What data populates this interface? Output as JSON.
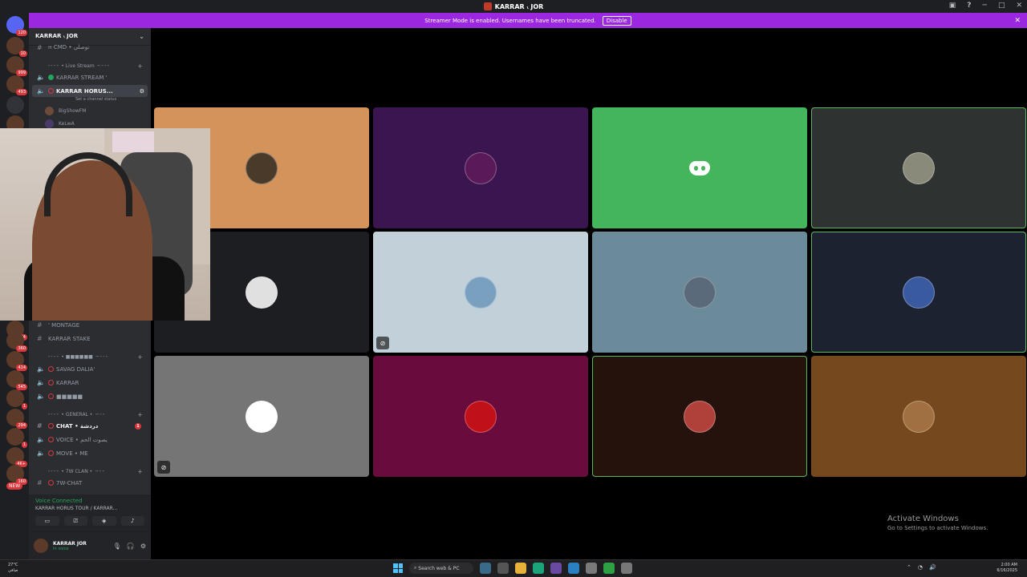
{
  "window": {
    "title": "KARRAR ៶ JOR"
  },
  "banner": {
    "text": "Streamer Mode is enabled. Usernames have been truncated.",
    "button": "Disable"
  },
  "guild_badges": [
    "120",
    "10",
    "999",
    "493",
    "34",
    "360",
    "414",
    "545",
    "1",
    "294",
    "1",
    "4K+",
    "160"
  ],
  "guild_new": "NEW",
  "server": {
    "name": "KARRAR ៶ JOR"
  },
  "sidebar": {
    "top_channel": "ʜ CMD • توصلی",
    "categories": {
      "live": "╴╴╴╴ • Live Stream ╶╴╴╴╴",
      "cat2": "╴╴╴╴ • ■■■■■■ ╶╴╴╴╴",
      "general": "╴╴╴╴ • GENERAL • ╶╴╴╴",
      "clan": "╴╴╴╴ • 7W CLAN • ╶╴╴╴"
    },
    "channels": {
      "stream": "KARRAR STREAM ' ",
      "horus": "KARRAR HORUS...",
      "montage": "' MONTAGE",
      "stake": "KARRAR STAKE",
      "savag": "SAVAG DALIA'",
      "karrar": "KARRAR",
      "blocks": "■■■■■",
      "chat": "CHAT • دردشة",
      "voice": "VOICE • يصوت الحم",
      "move": "MOVE • ME",
      "clanchat": "7W-CHAT"
    },
    "channel_status": "Set a channel status",
    "voice_users": [
      "BigShowFM",
      "KeLwA"
    ],
    "chat_unread": "1"
  },
  "voice_panel": {
    "title": "Voice Connected",
    "channel": "KARRAR HORUS TOUR / KARRAR..."
  },
  "user": {
    "name": "KARRAR JOR",
    "status": "In voice"
  },
  "tiles": [
    {
      "bg": "#d4935a",
      "speaking": false,
      "muted": false,
      "avatar": "#4a3a2a"
    },
    {
      "bg": "#3a1550",
      "speaking": false,
      "muted": false,
      "avatar": "#5a1a5a"
    },
    {
      "bg": "#43b55c",
      "speaking": false,
      "muted": false,
      "avatar": "discord"
    },
    {
      "bg": "#2e3331",
      "speaking": true,
      "muted": false,
      "avatar": "#8a8a7a"
    },
    {
      "bg": "#1c1e21",
      "speaking": false,
      "muted": false,
      "avatar": "#e0e0e0"
    },
    {
      "bg": "#c2d0d9",
      "speaking": false,
      "muted": true,
      "avatar": "#7aa0c0"
    },
    {
      "bg": "#6c8b9a",
      "speaking": false,
      "muted": false,
      "avatar": "#5a6a7a"
    },
    {
      "bg": "#1d2230",
      "speaking": true,
      "muted": false,
      "avatar": "#3a5aa0"
    },
    {
      "bg": "#757575",
      "speaking": false,
      "muted": true,
      "avatar": "#ffffff"
    },
    {
      "bg": "#6a0b3e",
      "speaking": false,
      "muted": false,
      "avatar": "#c0101a"
    },
    {
      "bg": "#25120d",
      "speaking": true,
      "muted": false,
      "avatar": "#b0403a"
    },
    {
      "bg": "#76481e",
      "speaking": false,
      "muted": false,
      "avatar": "#a07040"
    }
  ],
  "activate": {
    "title": "Activate Windows",
    "sub": "Go to Settings to activate Windows."
  },
  "taskbar": {
    "temp": "27°C",
    "weather": "صافي",
    "search": "Search web & PC",
    "time": "2:00 AM",
    "date": "6/16/2025"
  }
}
